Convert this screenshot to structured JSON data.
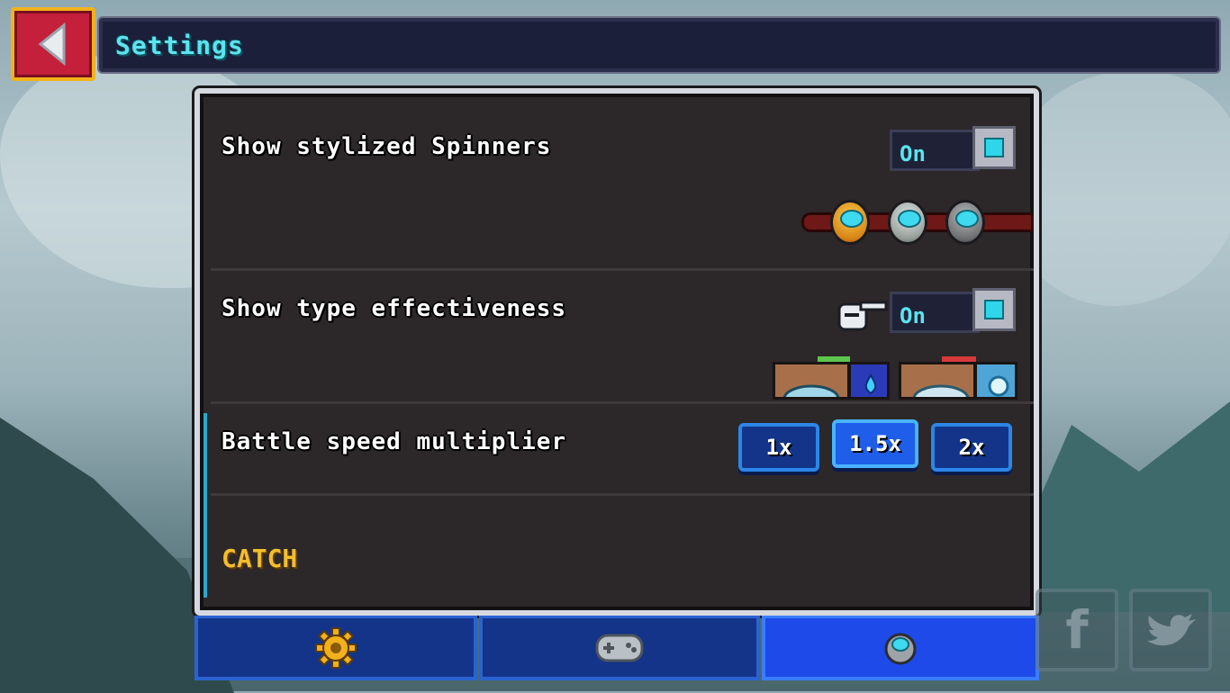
{
  "header": {
    "title": "Settings"
  },
  "rows": {
    "stylized_spinners": {
      "label": "Show stylized Spinners",
      "toggle": "On"
    },
    "type_effectiveness": {
      "label": "Show type effectiveness",
      "toggle": "On"
    },
    "battle_speed": {
      "label": "Battle speed multiplier",
      "options": [
        "1x",
        "1.5x",
        "2x"
      ],
      "selected": "1.5x"
    }
  },
  "section": {
    "catch_label": "CATCH"
  },
  "tabs": [
    {
      "icon": "gear-icon",
      "active": false
    },
    {
      "icon": "gamepad-icon",
      "active": false
    },
    {
      "icon": "spinner-icon",
      "active": true
    }
  ],
  "social": {
    "facebook": "f",
    "twitter": "twitter-bird-icon"
  },
  "colors": {
    "accent_cyan": "#5ce3ee",
    "tab_active": "#1d4ae8",
    "back_button": "#c41f3b",
    "section_gold": "#f4bd2c"
  }
}
